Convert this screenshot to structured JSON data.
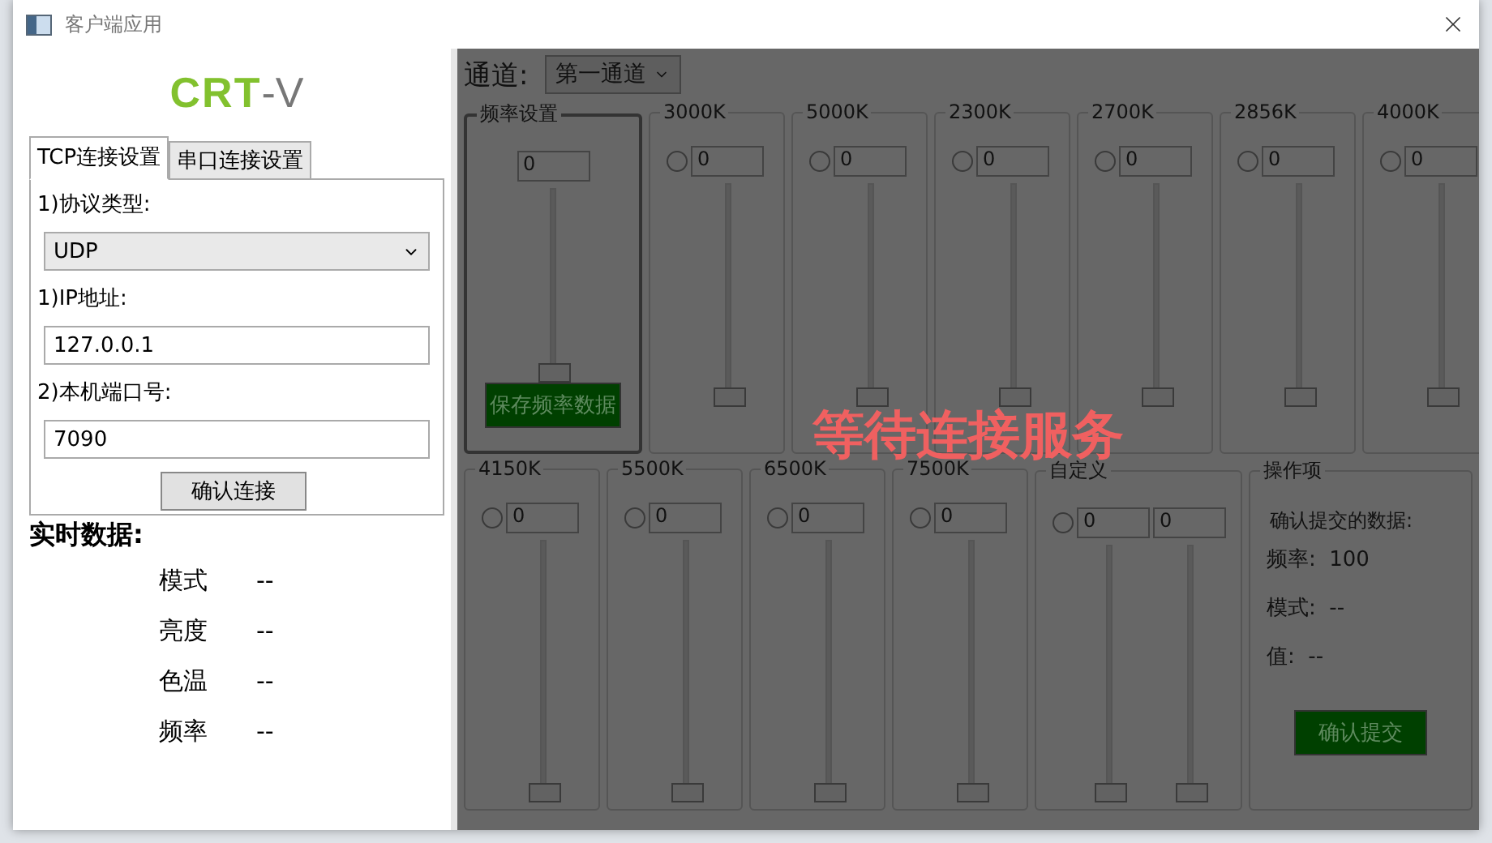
{
  "window": {
    "title": "客户端应用"
  },
  "logo": {
    "main": "CRT",
    "suffix": "-V"
  },
  "tabs": [
    {
      "label": "TCP连接设置",
      "selected": true
    },
    {
      "label": "串口连接设置",
      "selected": false
    }
  ],
  "connection_form": {
    "protocol_label": "1)协议类型:",
    "protocol_value": "UDP",
    "ip_label": "1)IP地址:",
    "ip_value": "127.0.0.1",
    "port_label": "2)本机端口号:",
    "port_value": "7090",
    "connect_button": "确认连接"
  },
  "realtime": {
    "title": "实时数据:",
    "rows": [
      {
        "label": "模式",
        "value": "--"
      },
      {
        "label": "亮度",
        "value": "--"
      },
      {
        "label": "色温",
        "value": "--"
      },
      {
        "label": "频率",
        "value": "--"
      }
    ]
  },
  "control_panel": {
    "disabled": true,
    "overlay_text": "等待连接服务",
    "channel_label": "通道:",
    "channel_value": "第一通道",
    "rows": [
      [
        {
          "kind": "frequency",
          "label": "频率设置",
          "values": [
            "0"
          ],
          "sliders": [
            {
              "level": 0
            }
          ],
          "button": "保存频率数据"
        },
        {
          "kind": "temperature",
          "label": "3000K",
          "checked": false,
          "values": [
            "0"
          ],
          "sliders": [
            {
              "level": 0
            }
          ]
        },
        {
          "kind": "temperature",
          "label": "5000K",
          "checked": false,
          "values": [
            "0"
          ],
          "sliders": [
            {
              "level": 0
            }
          ]
        },
        {
          "kind": "temperature",
          "label": "2300K",
          "checked": false,
          "values": [
            "0"
          ],
          "sliders": [
            {
              "level": 0
            }
          ]
        },
        {
          "kind": "temperature",
          "label": "2700K",
          "checked": false,
          "values": [
            "0"
          ],
          "sliders": [
            {
              "level": 0
            }
          ]
        },
        {
          "kind": "temperature",
          "label": "2856K",
          "checked": false,
          "values": [
            "0"
          ],
          "sliders": [
            {
              "level": 0
            }
          ]
        },
        {
          "kind": "temperature",
          "label": "4000K",
          "checked": false,
          "values": [
            "0"
          ],
          "sliders": [
            {
              "level": 0
            }
          ]
        }
      ],
      [
        {
          "kind": "temperature",
          "label": "4150K",
          "checked": false,
          "values": [
            "0"
          ],
          "sliders": [
            {
              "level": 0
            }
          ]
        },
        {
          "kind": "temperature",
          "label": "5500K",
          "checked": false,
          "values": [
            "0"
          ],
          "sliders": [
            {
              "level": 0
            }
          ]
        },
        {
          "kind": "temperature",
          "label": "6500K",
          "checked": false,
          "values": [
            "0"
          ],
          "sliders": [
            {
              "level": 0
            }
          ]
        },
        {
          "kind": "temperature",
          "label": "7500K",
          "checked": false,
          "values": [
            "0"
          ],
          "sliders": [
            {
              "level": 0
            }
          ]
        },
        {
          "kind": "temperature",
          "label": "自定义",
          "checked": false,
          "values": [
            "0",
            "0"
          ],
          "sliders": [
            {
              "level": 0
            },
            {
              "level": 0
            }
          ]
        },
        {
          "kind": "operations",
          "label": "操作项",
          "heading": "确认提交的数据:",
          "items": [
            "频率:  100",
            "模式:  --",
            "值:  --"
          ],
          "button": "确认提交"
        }
      ]
    ]
  }
}
